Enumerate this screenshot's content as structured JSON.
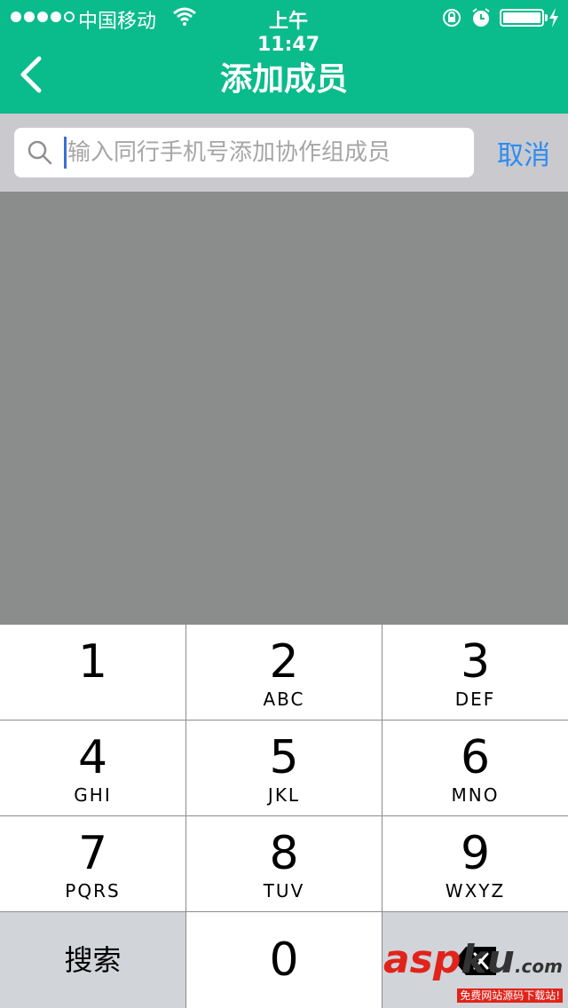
{
  "status_bar": {
    "carrier": "中国移动",
    "time": "上午11:47"
  },
  "header": {
    "title": "添加成员",
    "back_icon": "chevron-left-icon"
  },
  "search": {
    "placeholder": "输入同行手机号添加协作组成员",
    "value": "",
    "cancel_label": "取消"
  },
  "keypad": {
    "keys": [
      {
        "digit": "1",
        "letters": ""
      },
      {
        "digit": "2",
        "letters": "ABC"
      },
      {
        "digit": "3",
        "letters": "DEF"
      },
      {
        "digit": "4",
        "letters": "GHI"
      },
      {
        "digit": "5",
        "letters": "JKL"
      },
      {
        "digit": "6",
        "letters": "MNO"
      },
      {
        "digit": "7",
        "letters": "PQRS"
      },
      {
        "digit": "8",
        "letters": "TUV"
      },
      {
        "digit": "9",
        "letters": "WXYZ"
      }
    ],
    "search_label": "搜索",
    "zero": "0"
  },
  "watermark": {
    "brand_a": "asp",
    "brand_b": "ku",
    "brand_c": ".com",
    "tagline": "免费网站源码下载站!"
  },
  "colors": {
    "header_bg": "#0abb8c",
    "search_bar_bg": "#c9c9ce",
    "overlay": "#8a8d8c",
    "accent": "#2d8cf0"
  }
}
